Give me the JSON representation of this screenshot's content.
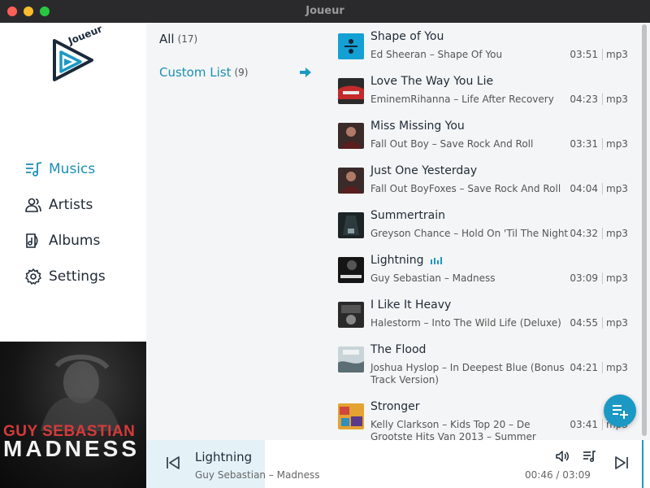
{
  "window": {
    "title": "Joueur"
  },
  "logo": {
    "text": "Joueur"
  },
  "nav": [
    {
      "id": "musics",
      "label": "Musics",
      "icon": "music-list-icon",
      "active": true
    },
    {
      "id": "artists",
      "label": "Artists",
      "icon": "people-icon",
      "active": false
    },
    {
      "id": "albums",
      "label": "Albums",
      "icon": "album-icon",
      "active": false
    },
    {
      "id": "settings",
      "label": "Settings",
      "icon": "gear-icon",
      "active": false
    }
  ],
  "lists": [
    {
      "name": "All",
      "count": "(17)",
      "active": false
    },
    {
      "name": "Custom List",
      "count": "(9)",
      "active": true
    }
  ],
  "tracks": [
    {
      "title": "Shape of You",
      "subtitle": "Ed Sheeran – Shape Of You",
      "duration": "03:51",
      "format": "mp3",
      "thumb": "thumb-shape-of-you"
    },
    {
      "title": "Love The Way You Lie",
      "subtitle": "EminemRihanna – Life After Recovery",
      "duration": "04:23",
      "format": "mp3",
      "thumb": "thumb-love-the-way"
    },
    {
      "title": "Miss Missing You",
      "subtitle": "Fall Out Boy – Save Rock And Roll",
      "duration": "03:31",
      "format": "mp3",
      "thumb": "thumb-fall-out-boy"
    },
    {
      "title": "Just One Yesterday",
      "subtitle": "Fall Out BoyFoxes – Save Rock And Roll",
      "duration": "04:04",
      "format": "mp3",
      "thumb": "thumb-fall-out-boy"
    },
    {
      "title": "Summertrain",
      "subtitle": "Greyson Chance – Hold On 'Til The Night",
      "duration": "04:32",
      "format": "mp3",
      "thumb": "thumb-summertrain"
    },
    {
      "title": "Lightning",
      "subtitle": "Guy Sebastian – Madness",
      "duration": "03:09",
      "format": "mp3",
      "thumb": "thumb-madness",
      "playing": true
    },
    {
      "title": "I Like It Heavy",
      "subtitle": "Halestorm – Into The Wild Life (Deluxe)",
      "duration": "04:55",
      "format": "mp3",
      "thumb": "thumb-halestorm"
    },
    {
      "title": "The Flood",
      "subtitle": "Joshua Hyslop – In Deepest Blue (Bonus Track Version)",
      "duration": "04:21",
      "format": "mp3",
      "thumb": "thumb-flood"
    },
    {
      "title": "Stronger",
      "subtitle": "Kelly Clarkson – Kids Top 20 – De Grootste Hits Van 2013 – Summer",
      "duration": "03:41",
      "format": "mp3",
      "thumb": "thumb-stronger"
    }
  ],
  "album_art": {
    "artist": "GUY SEBASTIAN",
    "title": "MADNESS"
  },
  "player": {
    "title": "Lightning",
    "subtitle": "Guy Sebastian – Madness",
    "position": "00:46",
    "duration": "03:09",
    "time_display": "00:46 / 03:09"
  },
  "colors": {
    "accent": "#1b99c4",
    "active_text": "#1b8fb5",
    "panel_bg": "#f4f5f6",
    "titlebar": "#2a2a2c"
  }
}
